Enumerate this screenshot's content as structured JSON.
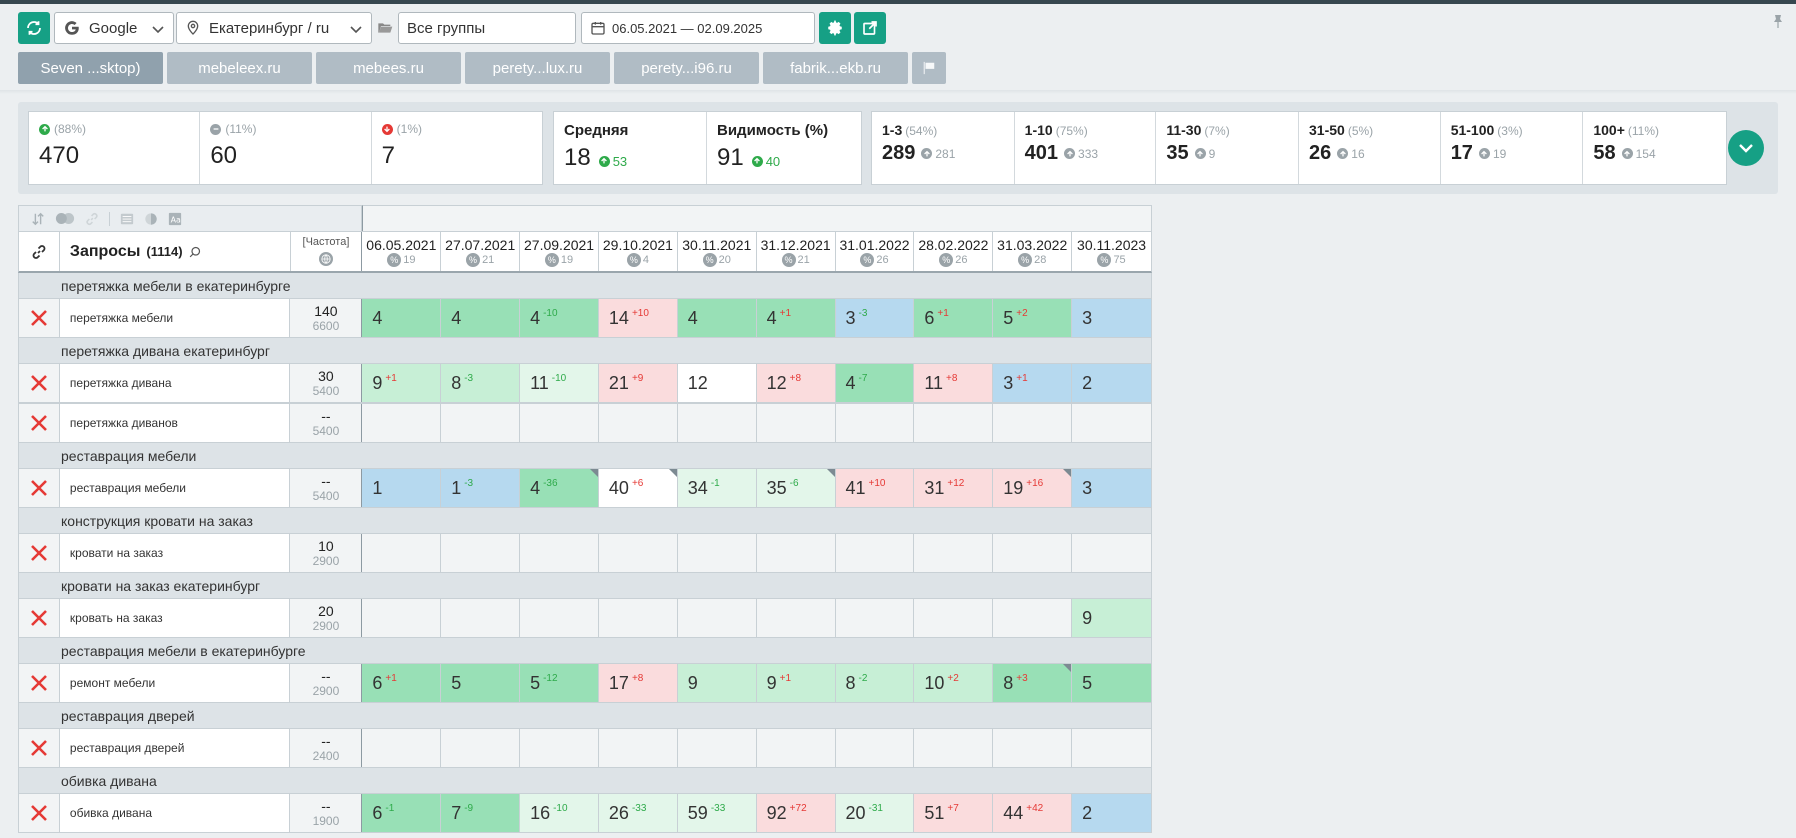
{
  "toolbar": {
    "engine": "Google",
    "region": "Екатеринбург / ru",
    "group": "Все группы",
    "date_range": "06.05.2021 — 02.09.2025"
  },
  "tabs": [
    {
      "label": "Seven ...sktop)",
      "active": true
    },
    {
      "label": "mebeleex.ru",
      "active": false
    },
    {
      "label": "mebees.ru",
      "active": false
    },
    {
      "label": "perety...lux.ru",
      "active": false
    },
    {
      "label": "perety...i96.ru",
      "active": false
    },
    {
      "label": "fabrik...ekb.ru",
      "active": false
    }
  ],
  "stats": {
    "up": {
      "pct": "(88%)",
      "value": "470"
    },
    "same": {
      "pct": "(11%)",
      "value": "60"
    },
    "down": {
      "pct": "(1%)",
      "value": "7"
    },
    "avg": {
      "title": "Средняя",
      "value": "18",
      "delta": "53"
    },
    "visibility": {
      "title": "Видимость (%)",
      "value": "91",
      "delta": "40"
    },
    "positions": [
      {
        "label": "1-3",
        "pct": "(54%)",
        "value": "289",
        "sub": "281"
      },
      {
        "label": "1-10",
        "pct": "(75%)",
        "value": "401",
        "sub": "333"
      },
      {
        "label": "11-30",
        "pct": "(7%)",
        "value": "35",
        "sub": "9"
      },
      {
        "label": "31-50",
        "pct": "(5%)",
        "value": "26",
        "sub": "16"
      },
      {
        "label": "51-100",
        "pct": "(3%)",
        "value": "17",
        "sub": "19"
      },
      {
        "label": "100+",
        "pct": "(11%)",
        "value": "58",
        "sub": "154"
      }
    ]
  },
  "grid": {
    "queries_title": "Запросы",
    "queries_count": "(1114)",
    "freq_title": "[Частота]",
    "dates": [
      {
        "date": "06.05.2021",
        "sub": "19"
      },
      {
        "date": "27.07.2021",
        "sub": "21"
      },
      {
        "date": "27.09.2021",
        "sub": "19"
      },
      {
        "date": "29.10.2021",
        "sub": "4"
      },
      {
        "date": "30.11.2021",
        "sub": "20"
      },
      {
        "date": "31.12.2021",
        "sub": "21"
      },
      {
        "date": "31.01.2022",
        "sub": "26"
      },
      {
        "date": "28.02.2022",
        "sub": "26"
      },
      {
        "date": "31.03.2022",
        "sub": "28"
      },
      {
        "date": "30.11.2023",
        "sub": "75"
      }
    ],
    "sections": [
      {
        "group": "перетяжка мебели в екатеринбурге",
        "rows": [
          {
            "query": "перетяжка мебели",
            "f1": "140",
            "f2": "6600",
            "cells": [
              {
                "v": "4",
                "c": "g1"
              },
              {
                "v": "4",
                "c": "g1"
              },
              {
                "v": "4",
                "d": "-10",
                "dir": "up",
                "c": "g1"
              },
              {
                "v": "14",
                "d": "+10",
                "dir": "dn",
                "c": "red"
              },
              {
                "v": "4",
                "c": "g1"
              },
              {
                "v": "4",
                "d": "+1",
                "dir": "dn",
                "c": "g1"
              },
              {
                "v": "3",
                "d": "-3",
                "dir": "up",
                "c": "top"
              },
              {
                "v": "6",
                "d": "+1",
                "dir": "dn",
                "c": "g1"
              },
              {
                "v": "5",
                "d": "+2",
                "dir": "dn",
                "c": "g1"
              },
              {
                "v": "3",
                "c": "top"
              }
            ]
          }
        ]
      },
      {
        "group": "перетяжка дивана екатеринбург",
        "rows": [
          {
            "query": "перетяжка дивана",
            "f1": "30",
            "f2": "5400",
            "cells": [
              {
                "v": "9",
                "d": "+1",
                "dir": "dn",
                "c": "g2"
              },
              {
                "v": "8",
                "d": "-3",
                "dir": "up",
                "c": "g2"
              },
              {
                "v": "11",
                "d": "-10",
                "dir": "up",
                "c": "g3"
              },
              {
                "v": "21",
                "d": "+9",
                "dir": "dn",
                "c": "red"
              },
              {
                "v": "12",
                "c": "white"
              },
              {
                "v": "12",
                "d": "+8",
                "dir": "dn",
                "c": "red"
              },
              {
                "v": "4",
                "d": "-7",
                "dir": "up",
                "c": "g1"
              },
              {
                "v": "11",
                "d": "+8",
                "dir": "dn",
                "c": "red"
              },
              {
                "v": "3",
                "d": "+1",
                "dir": "dn",
                "c": "top"
              },
              {
                "v": "2",
                "c": "top"
              }
            ]
          },
          {
            "query": "перетяжка диванов",
            "f1": "--",
            "f2": "5400",
            "cells": [
              {
                "v": "",
                "c": "empty"
              },
              {
                "v": "",
                "c": "empty"
              },
              {
                "v": "",
                "c": "empty"
              },
              {
                "v": "",
                "c": "empty"
              },
              {
                "v": "",
                "c": "empty"
              },
              {
                "v": "",
                "c": "empty"
              },
              {
                "v": "",
                "c": "empty"
              },
              {
                "v": "",
                "c": "empty"
              },
              {
                "v": "",
                "c": "empty"
              },
              {
                "v": "",
                "c": "empty"
              }
            ]
          }
        ]
      },
      {
        "group": "реставрация мебели",
        "rows": [
          {
            "query": "реставрация мебели",
            "f1": "--",
            "f2": "5400",
            "cells": [
              {
                "v": "1",
                "c": "top"
              },
              {
                "v": "1",
                "d": "-3",
                "dir": "up",
                "c": "top"
              },
              {
                "v": "4",
                "d": "-36",
                "dir": "up",
                "c": "g1",
                "corner": true
              },
              {
                "v": "40",
                "d": "+6",
                "dir": "dn",
                "c": "white",
                "corner": true
              },
              {
                "v": "34",
                "d": "-1",
                "dir": "up",
                "c": "g3"
              },
              {
                "v": "35",
                "d": "-6",
                "dir": "up",
                "c": "g3",
                "corner": true
              },
              {
                "v": "41",
                "d": "+10",
                "dir": "dn",
                "c": "red"
              },
              {
                "v": "31",
                "d": "+12",
                "dir": "dn",
                "c": "red"
              },
              {
                "v": "19",
                "d": "+16",
                "dir": "dn",
                "c": "red",
                "corner": true
              },
              {
                "v": "3",
                "c": "top"
              }
            ]
          }
        ]
      },
      {
        "group": "конструкция кровати на заказ",
        "rows": [
          {
            "query": "кровати на заказ",
            "f1": "10",
            "f2": "2900",
            "cells": [
              {
                "v": "",
                "c": "empty"
              },
              {
                "v": "",
                "c": "empty"
              },
              {
                "v": "",
                "c": "empty"
              },
              {
                "v": "",
                "c": "empty"
              },
              {
                "v": "",
                "c": "empty"
              },
              {
                "v": "",
                "c": "empty"
              },
              {
                "v": "",
                "c": "empty"
              },
              {
                "v": "",
                "c": "empty"
              },
              {
                "v": "",
                "c": "empty"
              },
              {
                "v": "",
                "c": "empty"
              }
            ]
          }
        ]
      },
      {
        "group": "кровати на заказ екатеринбург",
        "rows": [
          {
            "query": "кровать на заказ",
            "f1": "20",
            "f2": "2900",
            "cells": [
              {
                "v": "",
                "c": "empty"
              },
              {
                "v": "",
                "c": "empty"
              },
              {
                "v": "",
                "c": "empty"
              },
              {
                "v": "",
                "c": "empty"
              },
              {
                "v": "",
                "c": "empty"
              },
              {
                "v": "",
                "c": "empty"
              },
              {
                "v": "",
                "c": "empty"
              },
              {
                "v": "",
                "c": "empty"
              },
              {
                "v": "",
                "c": "empty"
              },
              {
                "v": "9",
                "c": "g2"
              }
            ]
          }
        ]
      },
      {
        "group": "реставрация мебели в екатеринбурге",
        "rows": [
          {
            "query": "ремонт мебели",
            "f1": "--",
            "f2": "2900",
            "cells": [
              {
                "v": "6",
                "d": "+1",
                "dir": "dn",
                "c": "g1"
              },
              {
                "v": "5",
                "c": "g1"
              },
              {
                "v": "5",
                "d": "-12",
                "dir": "up",
                "c": "g1"
              },
              {
                "v": "17",
                "d": "+8",
                "dir": "dn",
                "c": "red"
              },
              {
                "v": "9",
                "c": "g2"
              },
              {
                "v": "9",
                "d": "+1",
                "dir": "dn",
                "c": "g2"
              },
              {
                "v": "8",
                "d": "-2",
                "dir": "up",
                "c": "g2"
              },
              {
                "v": "10",
                "d": "+2",
                "dir": "dn",
                "c": "g2"
              },
              {
                "v": "8",
                "d": "+3",
                "dir": "dn",
                "c": "g1",
                "corner": true
              },
              {
                "v": "5",
                "c": "g1"
              }
            ]
          }
        ]
      },
      {
        "group": "реставрация дверей",
        "rows": [
          {
            "query": "реставрация дверей",
            "f1": "--",
            "f2": "2400",
            "cells": [
              {
                "v": "",
                "c": "empty"
              },
              {
                "v": "",
                "c": "empty"
              },
              {
                "v": "",
                "c": "empty"
              },
              {
                "v": "",
                "c": "empty"
              },
              {
                "v": "",
                "c": "empty"
              },
              {
                "v": "",
                "c": "empty"
              },
              {
                "v": "",
                "c": "empty"
              },
              {
                "v": "",
                "c": "empty"
              },
              {
                "v": "",
                "c": "empty"
              },
              {
                "v": "",
                "c": "empty"
              }
            ]
          }
        ]
      },
      {
        "group": "обивка дивана",
        "rows": [
          {
            "query": "обивка дивана",
            "f1": "--",
            "f2": "1900",
            "cells": [
              {
                "v": "6",
                "d": "-1",
                "dir": "up",
                "c": "g1"
              },
              {
                "v": "7",
                "d": "-9",
                "dir": "up",
                "c": "g1"
              },
              {
                "v": "16",
                "d": "-10",
                "dir": "up",
                "c": "g3"
              },
              {
                "v": "26",
                "d": "-33",
                "dir": "up",
                "c": "g3"
              },
              {
                "v": "59",
                "d": "-33",
                "dir": "up",
                "c": "g3"
              },
              {
                "v": "92",
                "d": "+72",
                "dir": "dn",
                "c": "red"
              },
              {
                "v": "20",
                "d": "-31",
                "dir": "up",
                "c": "g3"
              },
              {
                "v": "51",
                "d": "+7",
                "dir": "dn",
                "c": "red"
              },
              {
                "v": "44",
                "d": "+42",
                "dir": "dn",
                "c": "red"
              },
              {
                "v": "2",
                "c": "top"
              }
            ]
          }
        ]
      }
    ]
  }
}
